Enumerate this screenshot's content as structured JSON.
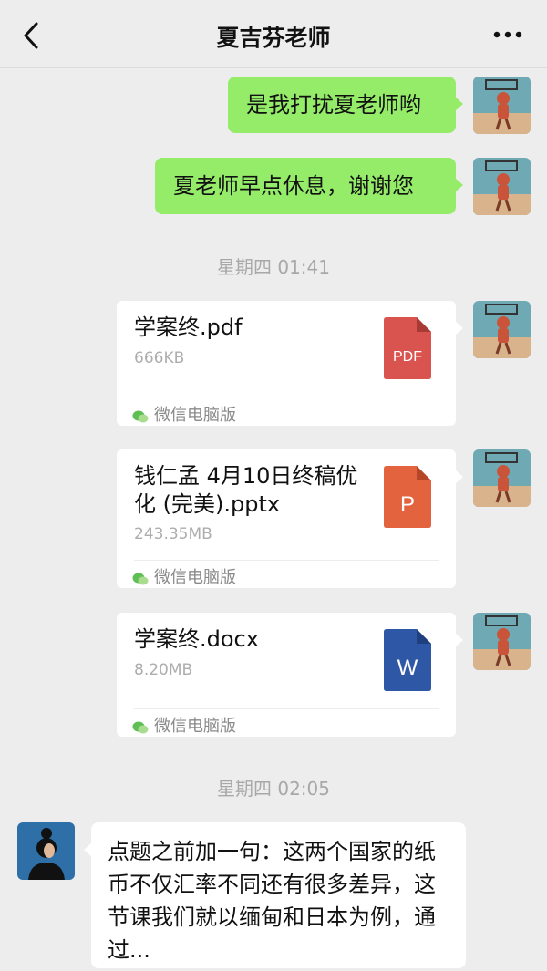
{
  "header": {
    "title": "夏吉芬老师"
  },
  "messages": {
    "m1": "是我打扰夏老师哟",
    "m2": "夏老师早点休息，谢谢您",
    "ts1": "星期四 01:41",
    "file1": {
      "name": "学案终.pdf",
      "size": "666KB",
      "source": "微信电脑版",
      "icon_label": "PDF",
      "icon_color": "#d9534f"
    },
    "file2": {
      "name": "钱仁孟 4月10日终稿优化 (完美).pptx",
      "size": "243.35MB",
      "source": "微信电脑版",
      "icon_label": "P",
      "icon_color": "#e4633f"
    },
    "file3": {
      "name": "学案终.docx",
      "size": "8.20MB",
      "source": "微信电脑版",
      "icon_label": "W",
      "icon_color": "#2e57a6"
    },
    "ts2": "星期四 02:05",
    "m3": "点题之前加一句：这两个国家的纸币不仅汇率不同还有很多差异，这节课我们就以缅甸和日本为例，通过..."
  },
  "colors": {
    "bg": "#ededed",
    "green_bubble": "#95ec69",
    "white_bubble": "#ffffff"
  },
  "icons": [
    "back-arrow-icon",
    "more-dots-icon",
    "wechat-pc-icon",
    "pdf-file-icon",
    "pptx-file-icon",
    "docx-file-icon"
  ]
}
